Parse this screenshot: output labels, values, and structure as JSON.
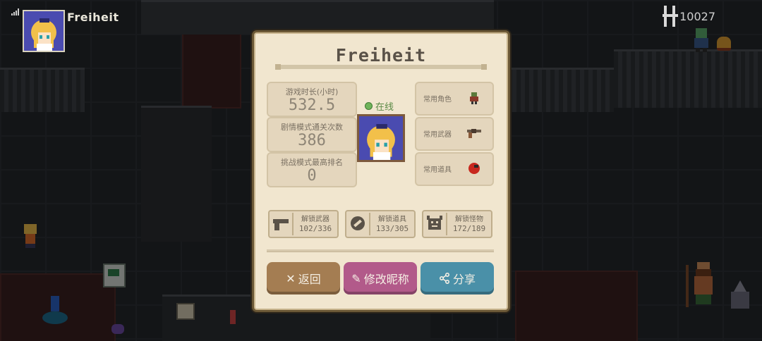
{
  "player": {
    "name": "Freiheit"
  },
  "hud": {
    "currency": "10027",
    "currency_icon": "gem-icon",
    "signal_icon": "signal-icon"
  },
  "profile": {
    "title": "Freiheit",
    "status": "在线",
    "stats": [
      {
        "label": "游戏时长(小时)",
        "value": "532.5"
      },
      {
        "label": "剧情模式通关次数",
        "value": "386"
      },
      {
        "label": "挑战模式最高排名",
        "value": "0"
      }
    ],
    "favorites": [
      {
        "label": "常用角色",
        "icon": "character-icon"
      },
      {
        "label": "常用武器",
        "icon": "revolver-icon"
      },
      {
        "label": "常用道具",
        "icon": "item-icon"
      }
    ],
    "unlocks": [
      {
        "label": "解锁武器",
        "count": "102/336",
        "icon": "pistol-icon"
      },
      {
        "label": "解锁道具",
        "count": "133/305",
        "icon": "capsule-icon"
      },
      {
        "label": "解锁怪物",
        "count": "172/189",
        "icon": "monster-icon"
      }
    ],
    "buttons": {
      "back": "返回",
      "rename": "修改昵称",
      "share": "分享"
    }
  },
  "colors": {
    "back_button": "#a47d52",
    "rename_button": "#b25a8a",
    "share_button": "#4a90a8",
    "online": "#6fb35a",
    "panel": "#f1e6cf"
  }
}
